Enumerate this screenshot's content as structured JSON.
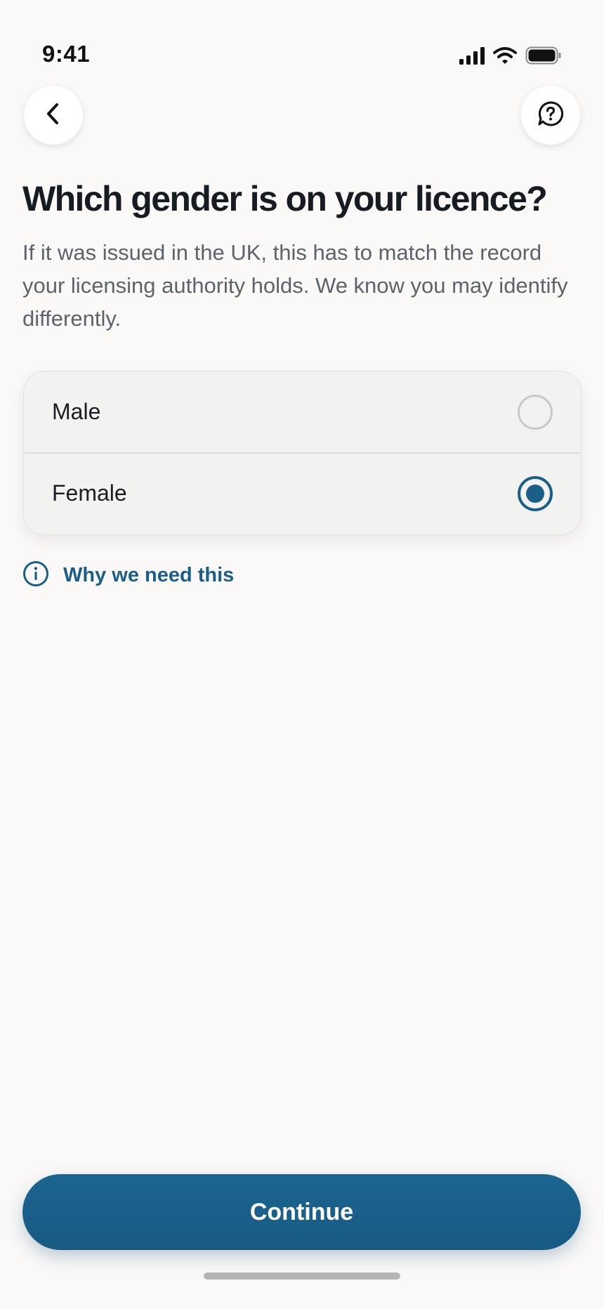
{
  "status_bar": {
    "time": "9:41",
    "icons": [
      "cellular-signal-icon",
      "wifi-icon",
      "battery-icon"
    ]
  },
  "nav": {
    "back_icon": "chevron-left-icon",
    "help_icon": "help-chat-icon"
  },
  "question": {
    "title": "Which gender is on your licence?",
    "subtitle": "If it was issued in the UK, this has to match the record your licensing authority holds. We know you may identify differently."
  },
  "options": [
    {
      "label": "Male",
      "selected": false
    },
    {
      "label": "Female",
      "selected": true
    }
  ],
  "info_link": {
    "icon": "info-icon",
    "label": "Why we need this"
  },
  "footer": {
    "continue_label": "Continue"
  },
  "colors": {
    "accent": "#1b5e88",
    "background": "#faf9f8",
    "text_primary": "#171b22",
    "text_secondary": "#5d636a"
  }
}
